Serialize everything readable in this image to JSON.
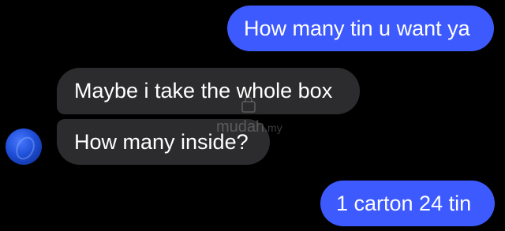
{
  "conversation": {
    "messages": [
      {
        "sender": "me",
        "text": "How many tin u want ya"
      },
      {
        "sender": "other",
        "text": "Maybe i take the whole box"
      },
      {
        "sender": "other",
        "text": "How many inside?"
      },
      {
        "sender": "me",
        "text": "1 carton 24 tin"
      }
    ]
  },
  "watermark": {
    "name": "mudah",
    "tld": ".my"
  },
  "colors": {
    "background": "#000000",
    "sent_bubble": "#3d5afe",
    "received_bubble": "#2c2c2e",
    "text": "#ffffff"
  },
  "icons": {
    "avatar": "contact-avatar",
    "watermark": "mudah-bag-icon"
  }
}
